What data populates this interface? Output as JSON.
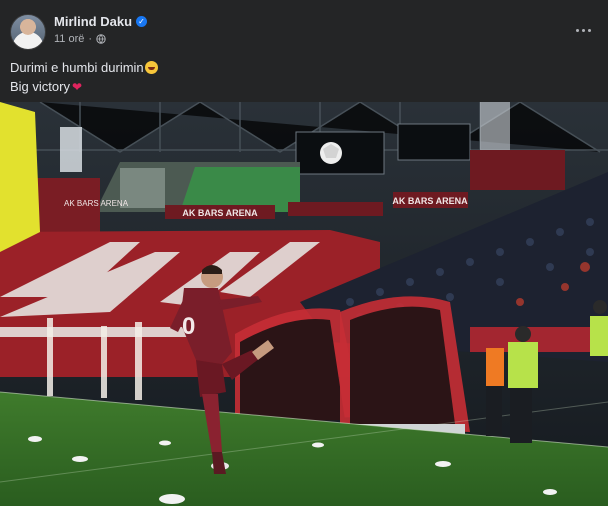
{
  "post": {
    "author": "Mirlind Daku",
    "time": "11 orë",
    "caption_line1": "Durimi e humbi durimin",
    "caption_line2": "Big victory"
  },
  "photo": {
    "signs": [
      "AK BARS ARENA",
      "AK BARS ARENA",
      "AK BARS ARENA"
    ],
    "player_number": "0"
  },
  "colors": {
    "background": "#242526",
    "text_primary": "#e4e6eb",
    "text_secondary": "#b0b3b8",
    "verified_blue": "#1877f2",
    "heart_red": "#e0245e"
  },
  "icons": {
    "verified": "verified-badge-icon",
    "privacy": "globe-icon",
    "menu": "more-options-icon",
    "emoji": "laughing-emoji-icon",
    "heart": "red-heart-icon"
  }
}
